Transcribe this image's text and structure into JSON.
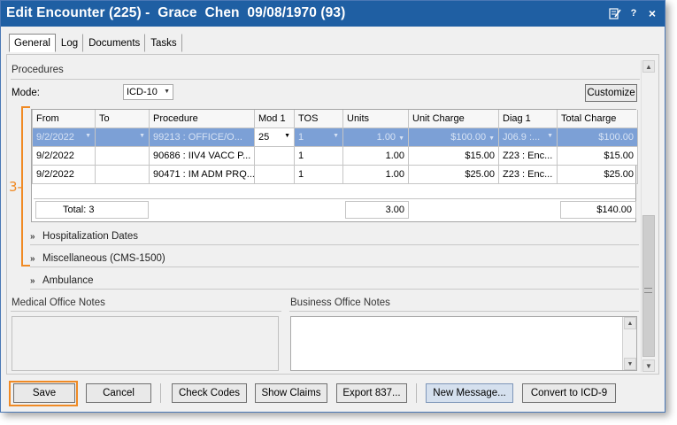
{
  "window": {
    "title": "Edit Encounter (225) -  Grace  Chen  09/08/1970 (93)",
    "icons": [
      "edit-notes-icon",
      "help-icon",
      "close-icon"
    ],
    "help_glyph": "?",
    "close_glyph": "×"
  },
  "tabs": [
    "General",
    "Log",
    "Documents",
    "Tasks"
  ],
  "procedures": {
    "section_title": "Procedures",
    "mode_label": "Mode:",
    "mode_value": "ICD-10",
    "customize_label": "Customize",
    "columns": [
      "From",
      "To",
      "Procedure",
      "Mod 1",
      "TOS",
      "Units",
      "Unit Charge",
      "Diag 1",
      "Total Charge"
    ],
    "rows": [
      {
        "from": "9/2/2022",
        "to": "",
        "procedure": "99213 : OFFICE/O...",
        "mod1": "25",
        "tos": "1",
        "units": "1.00",
        "unit_charge": "$100.00",
        "diag1": "J06.9 :...",
        "total_charge": "$100.00"
      },
      {
        "from": "9/2/2022",
        "to": "",
        "procedure": "90686 : IIV4 VACC P...",
        "mod1": "",
        "tos": "1",
        "units": "1.00",
        "unit_charge": "$15.00",
        "diag1": "Z23 : Enc...",
        "total_charge": "$15.00"
      },
      {
        "from": "9/2/2022",
        "to": "",
        "procedure": "90471 : IM ADM PRQ...",
        "mod1": "",
        "tos": "1",
        "units": "1.00",
        "unit_charge": "$25.00",
        "diag1": "Z23 : Enc...",
        "total_charge": "$25.00"
      }
    ],
    "totals": {
      "label": "Total: 3",
      "units": "3.00",
      "total_charge": "$140.00"
    },
    "callout": "3"
  },
  "sections": [
    "Hospitalization Dates",
    "Miscellaneous (CMS-1500)",
    "Ambulance"
  ],
  "notes": {
    "medical_label": "Medical Office Notes",
    "business_label": "Business Office Notes"
  },
  "buttons": {
    "save": "Save",
    "cancel": "Cancel",
    "check_codes": "Check Codes",
    "show_claims": "Show Claims",
    "export": "Export 837...",
    "new_message": "New Message...",
    "convert": "Convert to ICD-9"
  },
  "colors": {
    "titlebar": "#1f5fa3",
    "selected_row": "#7ca0d6",
    "callout": "#f08a24"
  }
}
